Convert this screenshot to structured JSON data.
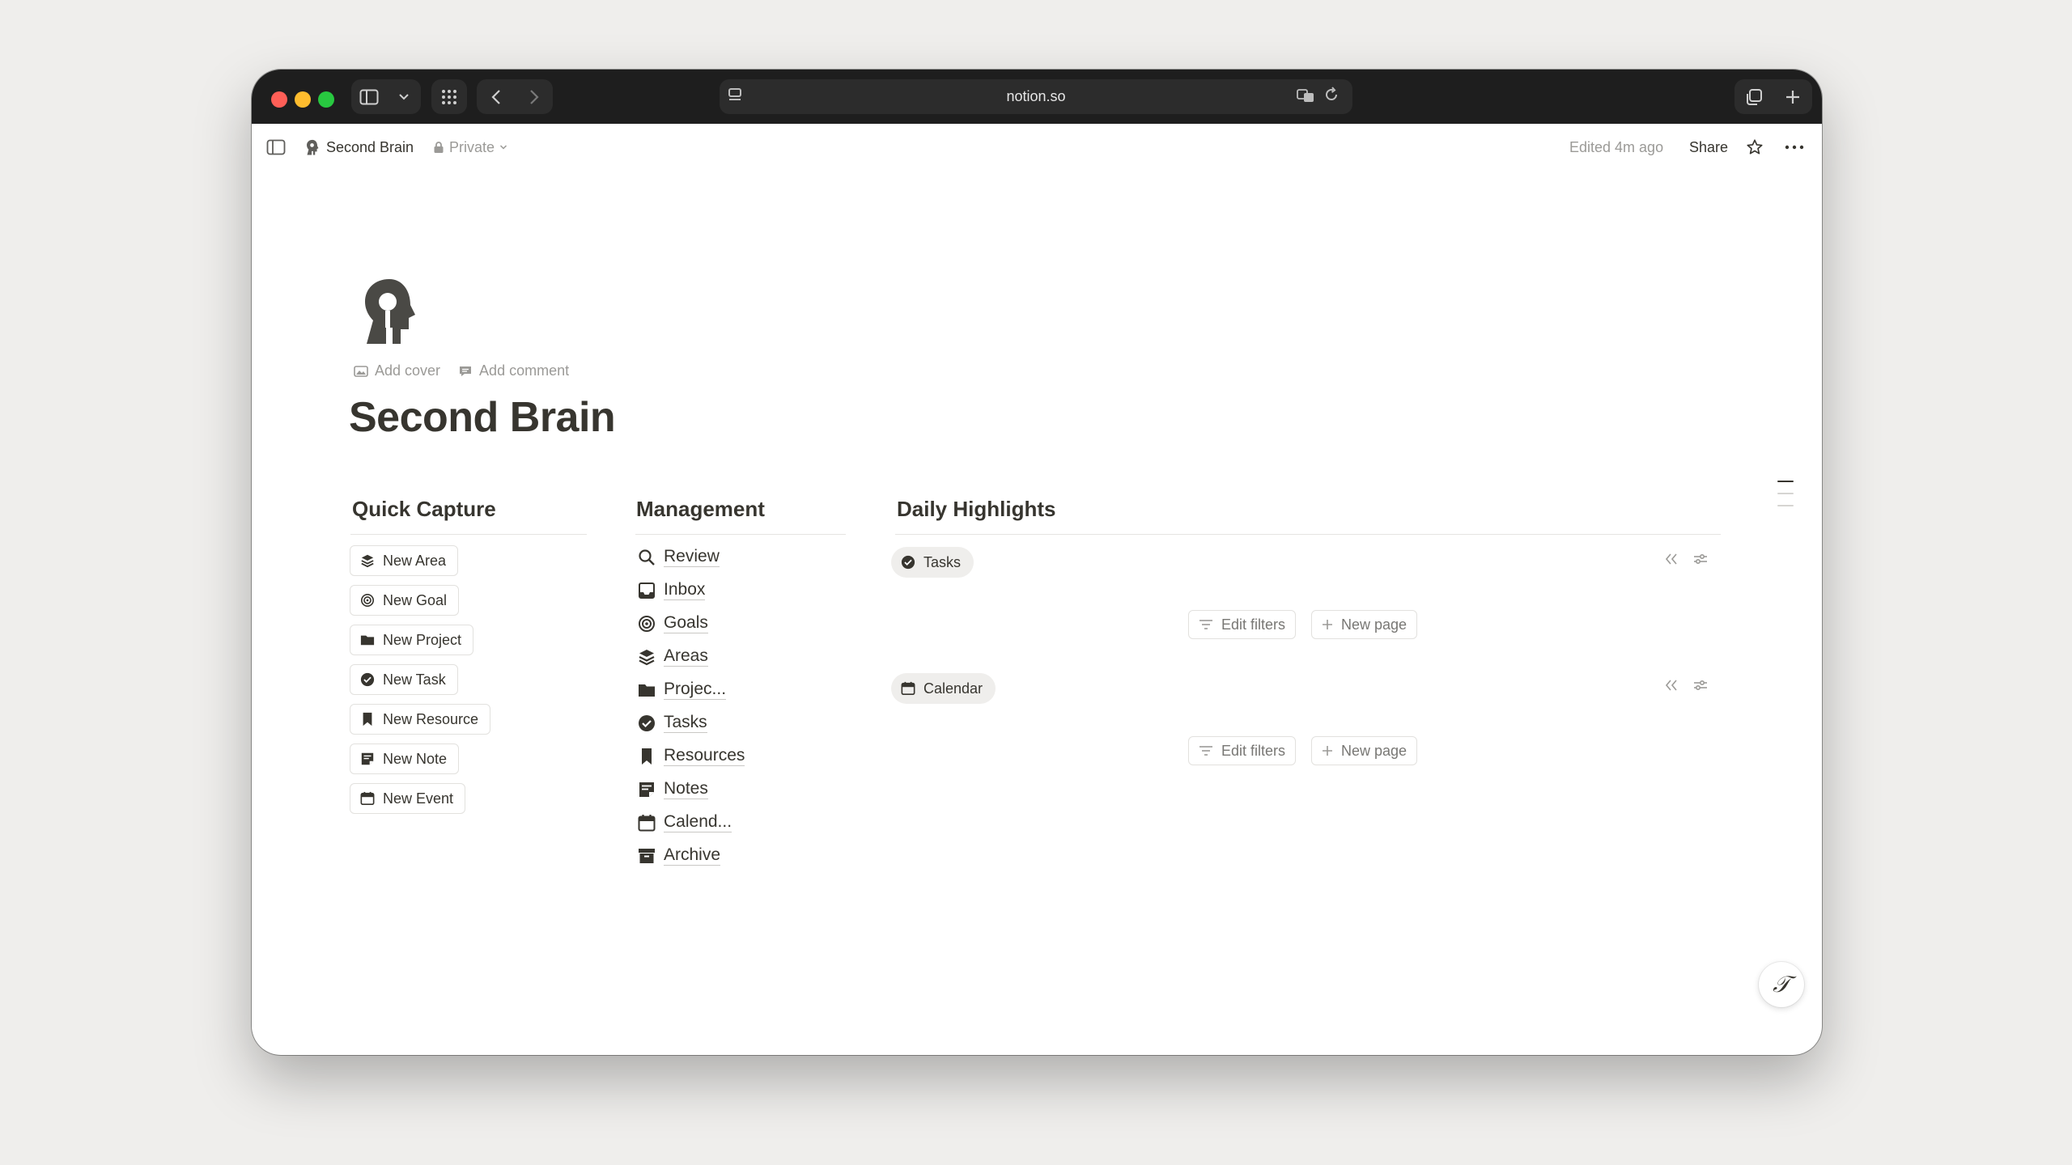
{
  "browser": {
    "url": "notion.so"
  },
  "topbar": {
    "breadcrumb_title": "Second Brain",
    "privacy": "Private",
    "edited": "Edited 4m ago",
    "share": "Share"
  },
  "page": {
    "icon": "head-icon",
    "add_cover": "Add cover",
    "add_comment": "Add comment",
    "title": "Second Brain"
  },
  "quick_capture": {
    "heading": "Quick Capture",
    "buttons": [
      {
        "label": "New Area",
        "icon": "layers-icon"
      },
      {
        "label": "New Goal",
        "icon": "target-icon"
      },
      {
        "label": "New Project",
        "icon": "folder-icon"
      },
      {
        "label": "New Task",
        "icon": "check-circle-icon"
      },
      {
        "label": "New Resource",
        "icon": "bookmark-icon"
      },
      {
        "label": "New Note",
        "icon": "note-icon"
      },
      {
        "label": "New Event",
        "icon": "calendar-icon"
      }
    ]
  },
  "management": {
    "heading": "Management",
    "items": [
      {
        "label": "Review",
        "icon": "search-icon"
      },
      {
        "label": "Inbox",
        "icon": "inbox-icon"
      },
      {
        "label": "Goals",
        "icon": "target-icon"
      },
      {
        "label": "Areas",
        "icon": "layers-icon"
      },
      {
        "label": "Projec...",
        "icon": "folder-icon"
      },
      {
        "label": "Tasks",
        "icon": "check-circle-icon"
      },
      {
        "label": "Resources",
        "icon": "bookmark-icon"
      },
      {
        "label": "Notes",
        "icon": "note-icon"
      },
      {
        "label": "Calend...",
        "icon": "calendar-icon"
      },
      {
        "label": "Archive",
        "icon": "archive-icon"
      }
    ]
  },
  "daily_highlights": {
    "heading": "Daily Highlights",
    "views": [
      {
        "tab": "Tasks",
        "icon": "check-circle-icon",
        "edit_filters": "Edit filters",
        "new_page": "New page"
      },
      {
        "tab": "Calendar",
        "icon": "calendar-icon",
        "edit_filters": "Edit filters",
        "new_page": "New page"
      }
    ]
  },
  "colors": {
    "text": "#37352f",
    "muted": "#9b9a97",
    "titlebar": "#1e1e1e"
  }
}
